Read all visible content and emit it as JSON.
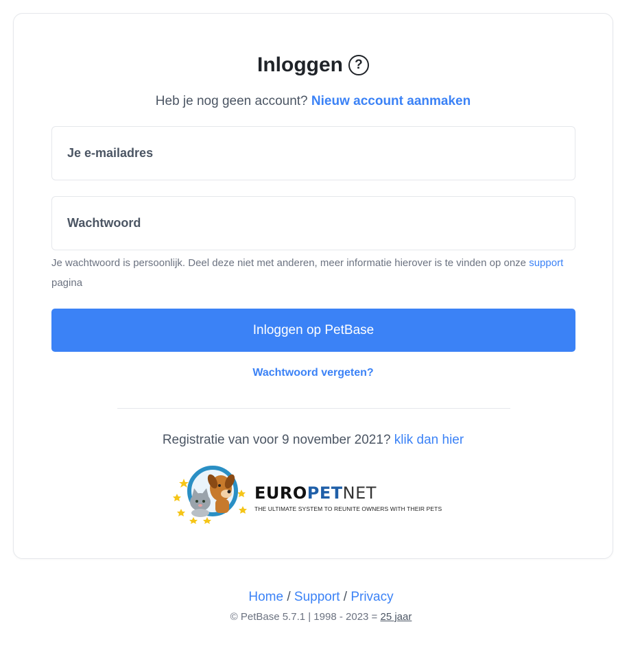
{
  "login": {
    "title": "Inloggen",
    "help_glyph": "?",
    "signup_prompt": "Heb je nog geen account? ",
    "signup_link": "Nieuw account aanmaken",
    "email_placeholder": "Je e-mailadres",
    "password_placeholder": "Wachtwoord",
    "hint_text": "Je wachtwoord is persoonlijk. Deel deze niet met anderen, meer informatie hierover is te vinden op onze ",
    "hint_link": "support",
    "hint_suffix": " pagina",
    "submit_label": "Inloggen op PetBase",
    "forgot_link": "Wachtwoord vergeten?",
    "legacy_prompt": "Registratie van voor 9 november 2021? ",
    "legacy_link": "klik dan hier"
  },
  "logo": {
    "brand_part1": "EURO",
    "brand_part2": "PET",
    "brand_part3": "NET",
    "tagline": "THE ULTIMATE SYSTEM TO REUNITE OWNERS WITH THEIR PETS"
  },
  "footer": {
    "home": "Home",
    "sep1": " / ",
    "support": "Support",
    "sep2": " / ",
    "privacy": "Privacy",
    "copyright_prefix": "© PetBase 5.7.1 | 1998 - 2023 = ",
    "copyright_years": "25 jaar"
  },
  "colors": {
    "accent": "#3b82f6",
    "title": "#1f2328",
    "border": "#e5e7eb"
  }
}
